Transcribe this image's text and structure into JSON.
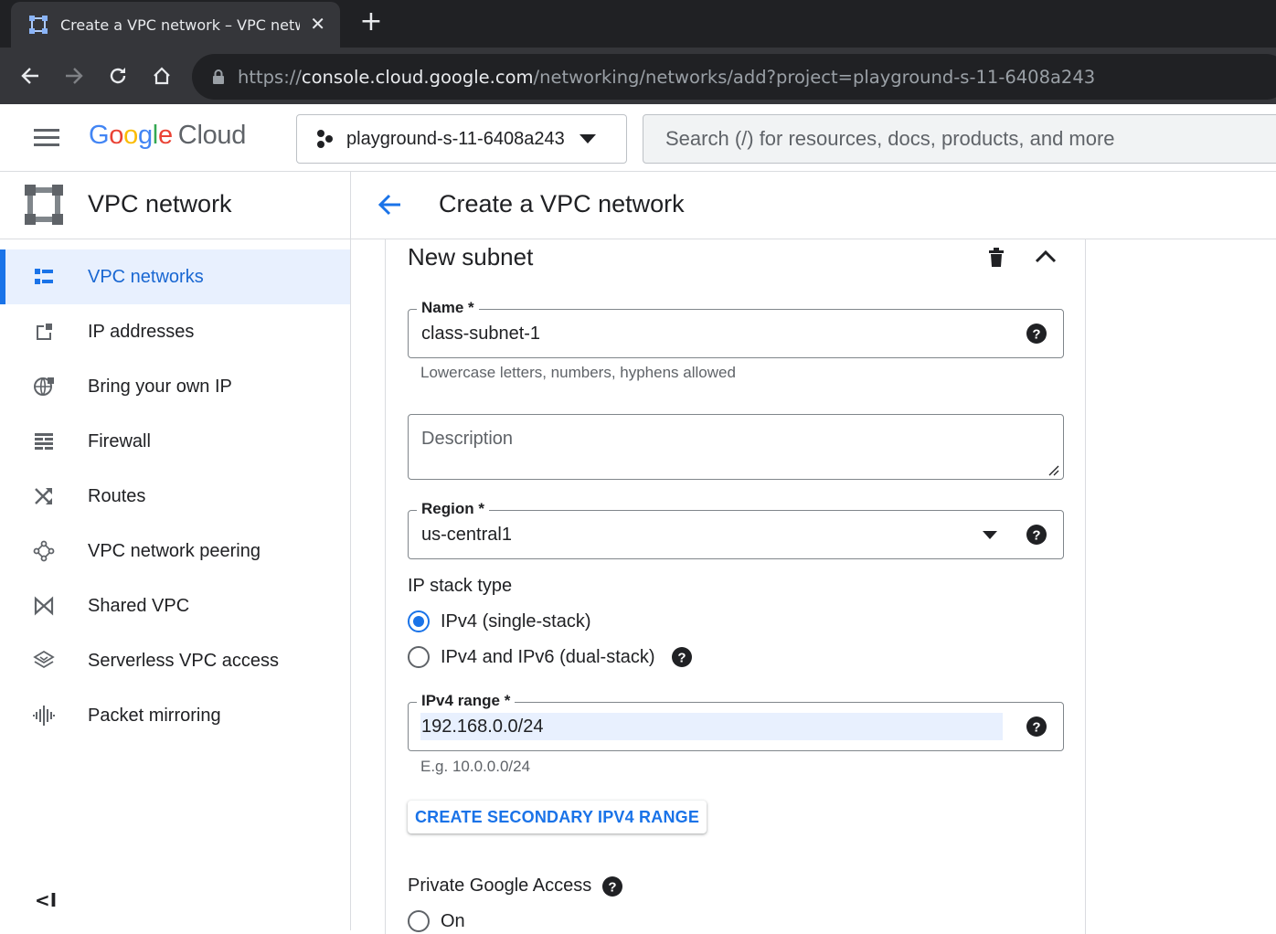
{
  "browser": {
    "tab_title": "Create a VPC network – VPC netw",
    "close_glyph": "✕",
    "newtab_glyph": "+",
    "url_scheme": "https://",
    "url_host": "console.cloud.google.com",
    "url_path": "/networking/networks/add?project=playground-s-11-6408a243"
  },
  "header": {
    "logo_google": [
      "G",
      "o",
      "o",
      "g",
      "l",
      "e"
    ],
    "logo_cloud": "Cloud",
    "project_name": "playground-s-11-6408a243",
    "search_placeholder": "Search (/) for resources, docs, products, and more"
  },
  "sidebar": {
    "product_title": "VPC network",
    "items": [
      {
        "label": "VPC networks",
        "icon": "vpc-networks-icon",
        "active": true
      },
      {
        "label": "IP addresses",
        "icon": "ip-addresses-icon"
      },
      {
        "label": "Bring your own IP",
        "icon": "globe-icon"
      },
      {
        "label": "Firewall",
        "icon": "firewall-icon"
      },
      {
        "label": "Routes",
        "icon": "routes-icon"
      },
      {
        "label": "VPC network peering",
        "icon": "peering-icon"
      },
      {
        "label": "Shared VPC",
        "icon": "shared-vpc-icon"
      },
      {
        "label": "Serverless VPC access",
        "icon": "serverless-icon"
      },
      {
        "label": "Packet mirroring",
        "icon": "packet-mirroring-icon"
      }
    ],
    "collapse_glyph": "<I"
  },
  "main": {
    "page_title": "Create a VPC network",
    "subnet_title": "New subnet",
    "name_label": "Name *",
    "name_value": "class-subnet-1",
    "name_hint": "Lowercase letters, numbers, hyphens allowed",
    "description_placeholder": "Description",
    "region_label": "Region *",
    "region_value": "us-central1",
    "ip_stack_label": "IP stack type",
    "ip_stack_options": [
      {
        "label": "IPv4 (single-stack)",
        "checked": true
      },
      {
        "label": "IPv4 and IPv6 (dual-stack)",
        "checked": false
      }
    ],
    "ipv4_label": "IPv4 range *",
    "ipv4_value": "192.168.0.0/24",
    "ipv4_hint": "E.g. 10.0.0.0/24",
    "secondary_button": "CREATE SECONDARY IPV4 RANGE",
    "private_access_label": "Private Google Access",
    "private_access_option": "On"
  },
  "colors": {
    "accent": "#1a73e8",
    "chrome_dark": "#202124",
    "chrome_mid": "#35363a"
  }
}
